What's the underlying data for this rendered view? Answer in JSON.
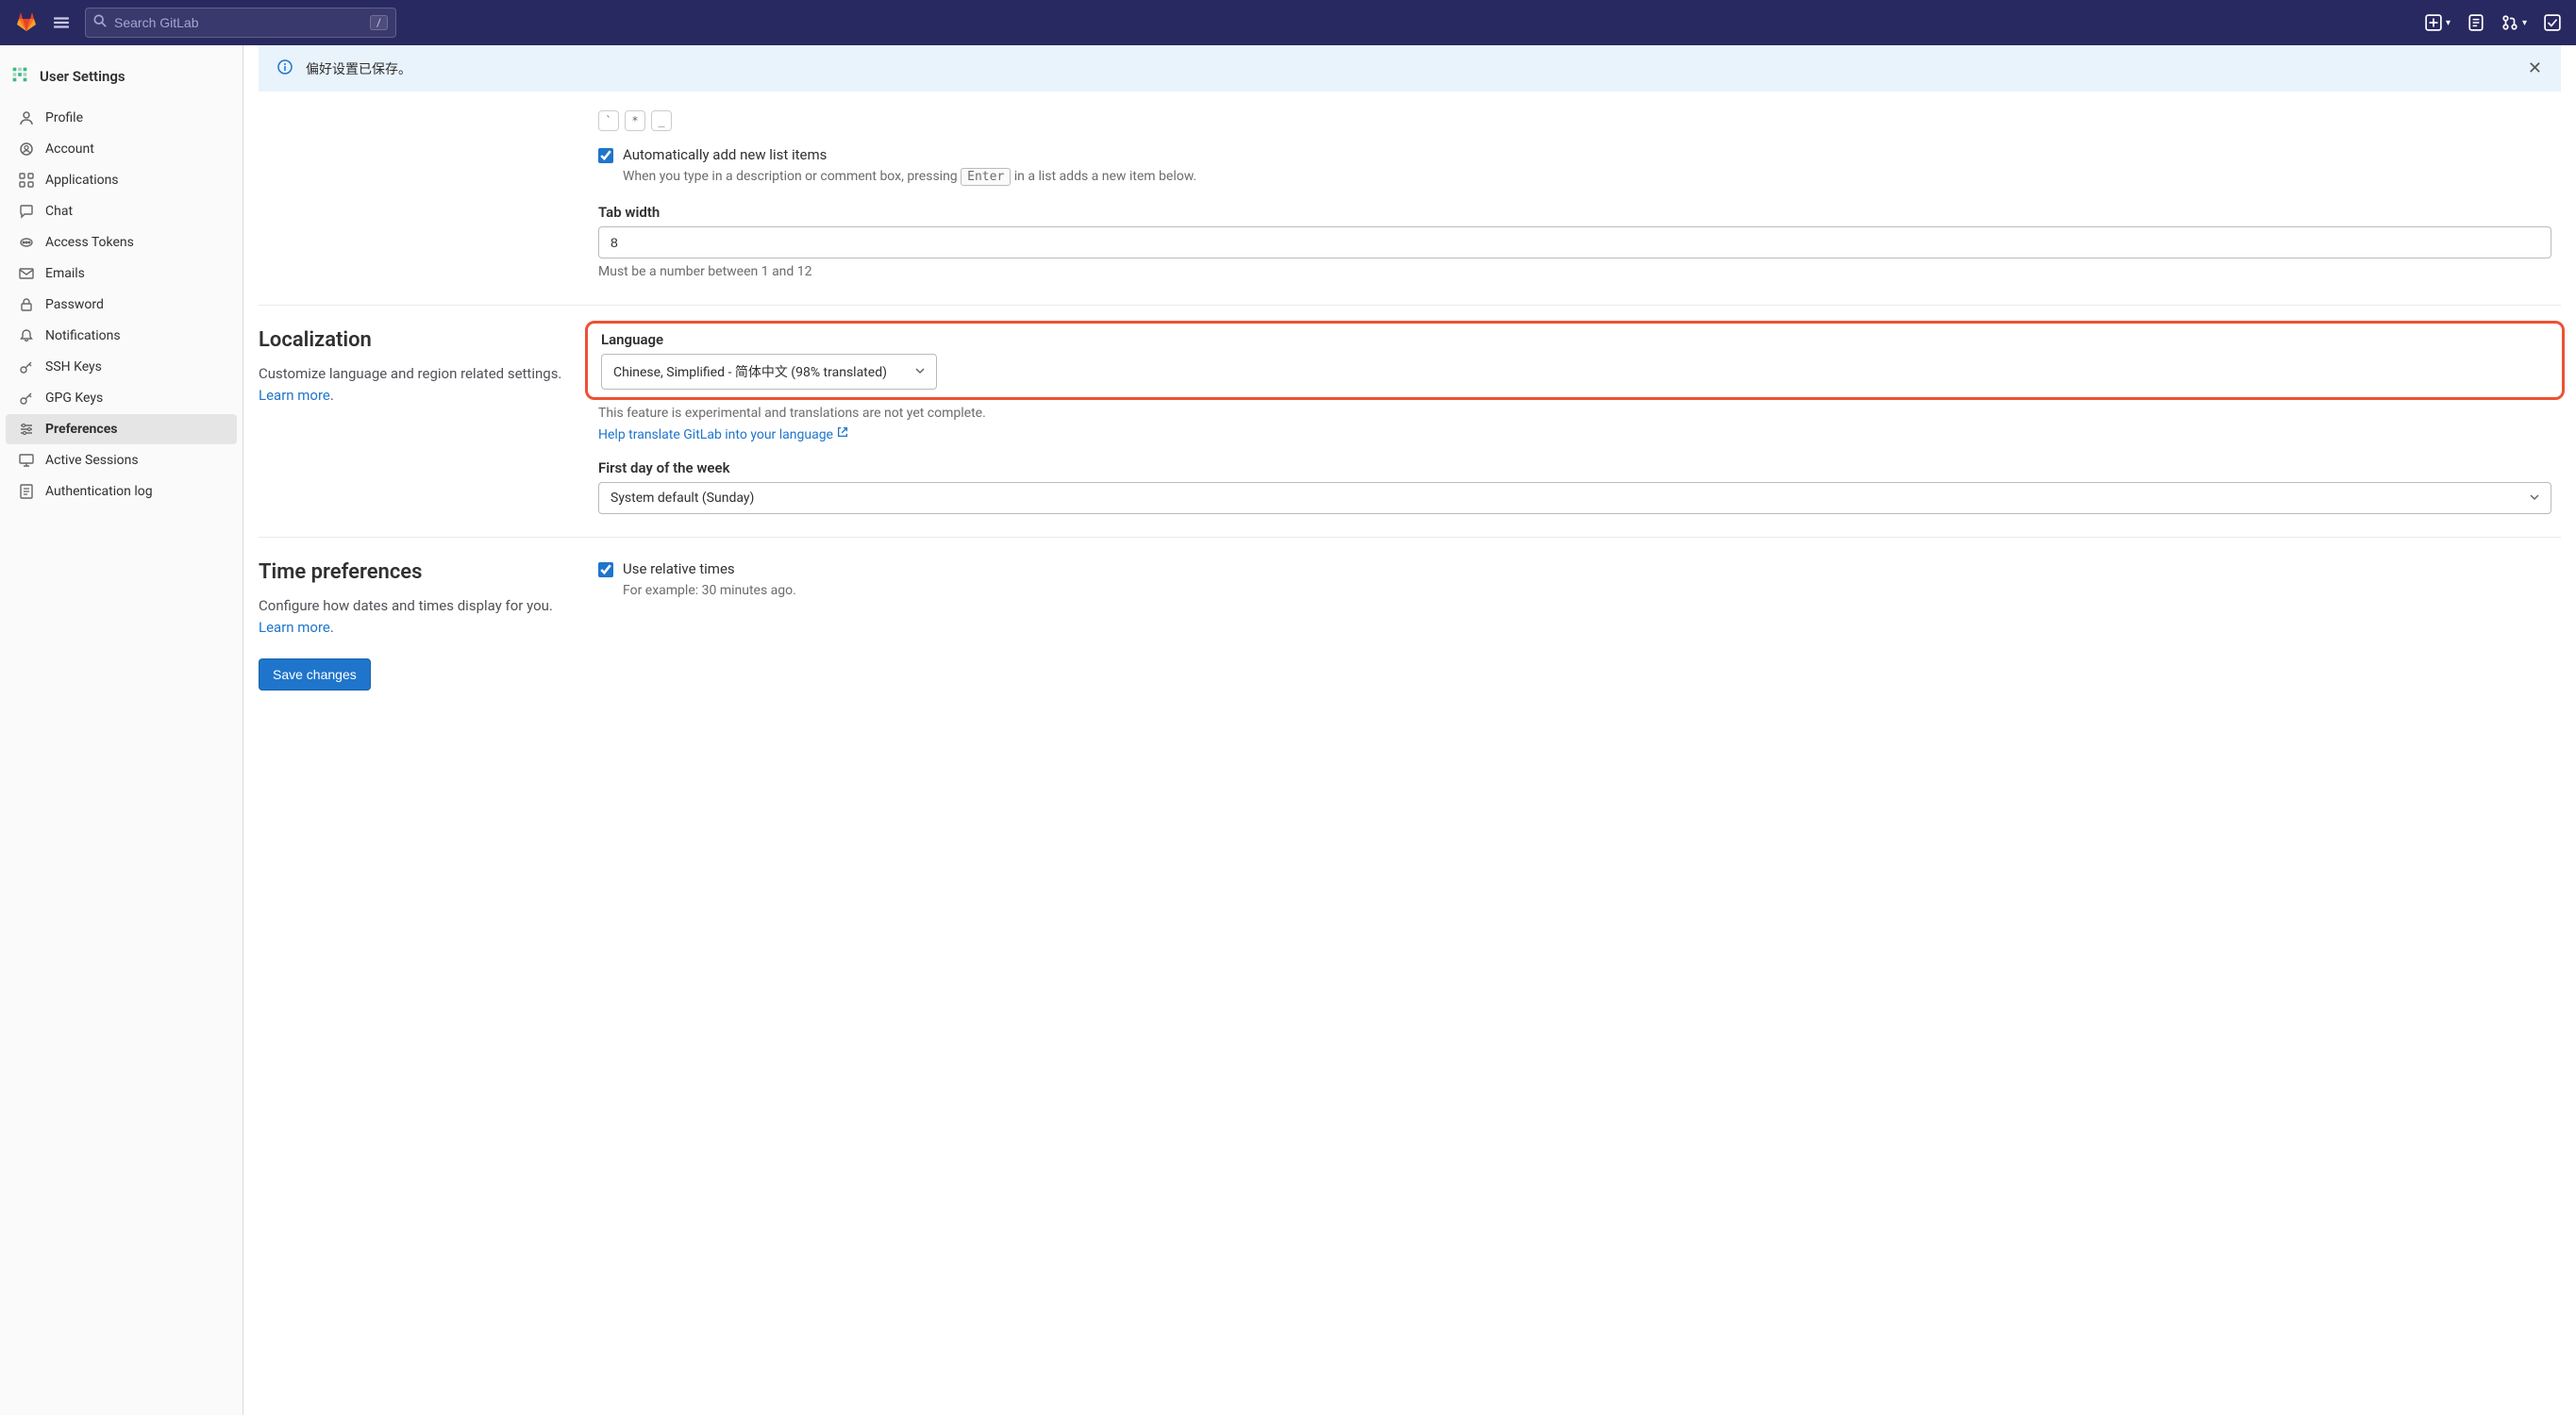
{
  "navbar": {
    "search_placeholder": "Search GitLab",
    "search_shortcut": "/"
  },
  "sidebar": {
    "header": "User Settings",
    "items": [
      {
        "label": "Profile"
      },
      {
        "label": "Account"
      },
      {
        "label": "Applications"
      },
      {
        "label": "Chat"
      },
      {
        "label": "Access Tokens"
      },
      {
        "label": "Emails"
      },
      {
        "label": "Password"
      },
      {
        "label": "Notifications"
      },
      {
        "label": "SSH Keys"
      },
      {
        "label": "GPG Keys"
      },
      {
        "label": "Preferences"
      },
      {
        "label": "Active Sessions"
      },
      {
        "label": "Authentication log"
      }
    ]
  },
  "alert": {
    "text": "偏好设置已保存。"
  },
  "partial_top": {
    "checkbox_label": "Automatically add new list items",
    "checkbox_help_pre": "When you type in a description or comment box, pressing ",
    "checkbox_kbd": "Enter",
    "checkbox_help_post": " in a list adds a new item below.",
    "tab_width_label": "Tab width",
    "tab_width_value": "8",
    "tab_width_help": "Must be a number between 1 and 12"
  },
  "localization": {
    "title": "Localization",
    "desc": "Customize language and region related settings. ",
    "learn_more": "Learn more",
    "language_label": "Language",
    "language_value": "Chinese, Simplified - 简体中文 (98% translated)",
    "language_help": "This feature is experimental and translations are not yet complete.",
    "help_translate": "Help translate GitLab into your language",
    "first_day_label": "First day of the week",
    "first_day_value": "System default (Sunday)"
  },
  "time": {
    "title": "Time preferences",
    "desc": "Configure how dates and times display for you. ",
    "learn_more": "Learn more",
    "relative_label": "Use relative times",
    "relative_help": "For example: 30 minutes ago."
  },
  "save_button": "Save changes"
}
